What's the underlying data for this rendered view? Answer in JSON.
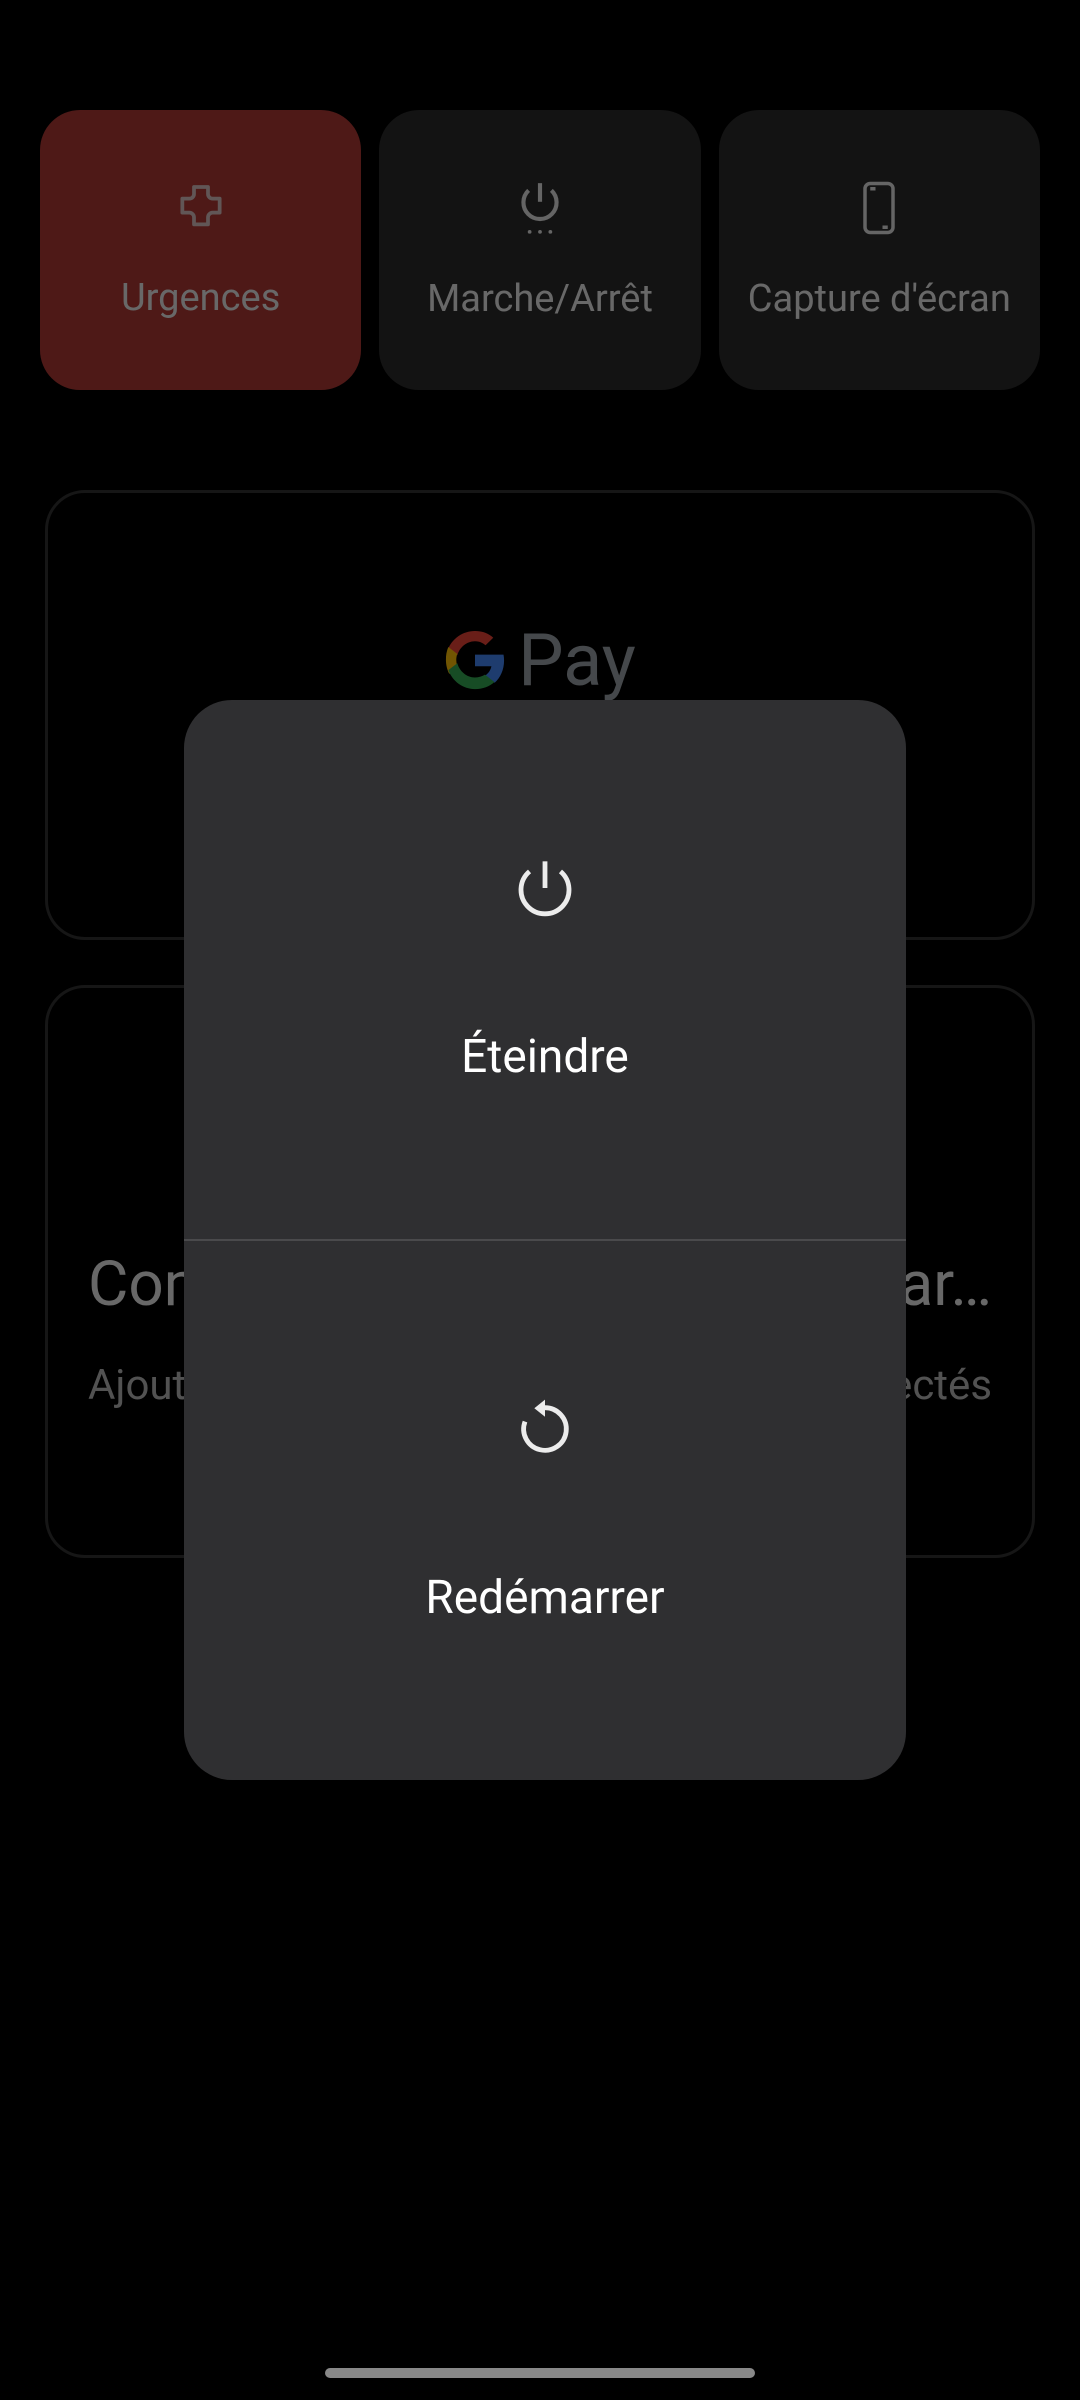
{
  "power_menu": {
    "tiles": {
      "emergency": {
        "label": "Urgences"
      },
      "power": {
        "label": "Marche/Arrêt"
      },
      "screenshot": {
        "label": "Capture d'écran"
      }
    },
    "gpay": {
      "brand_g": "G",
      "brand_pay": "Pay"
    },
    "home_card": {
      "title_left": "Comn",
      "title_right": "par…",
      "sub_left": "Ajoute",
      "sub_right": "nectés"
    }
  },
  "dialog": {
    "shutdown_label": "Éteindre",
    "restart_label": "Redémarrer"
  }
}
